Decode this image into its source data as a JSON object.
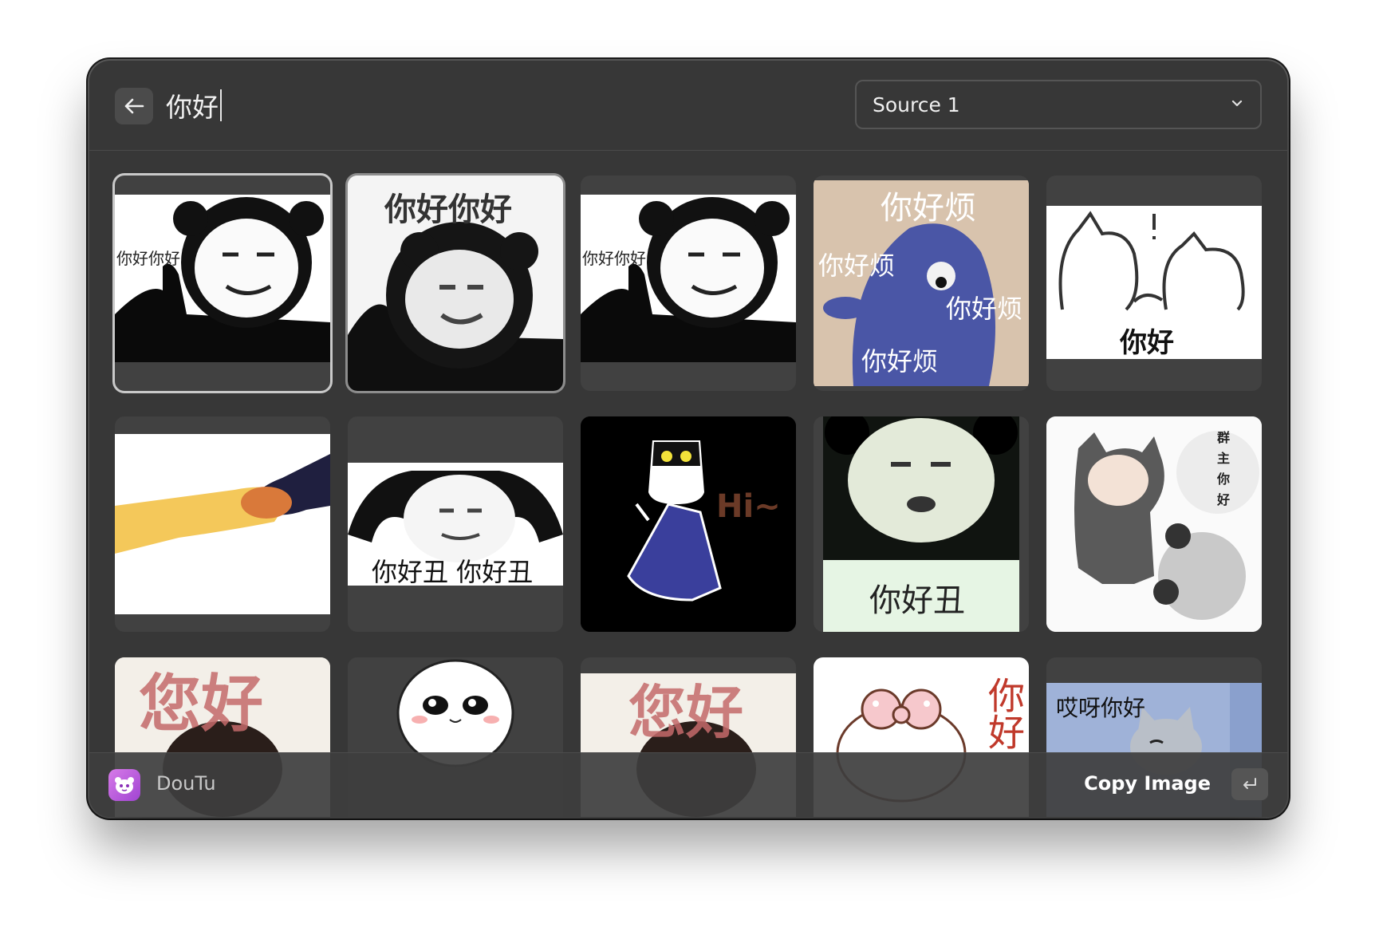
{
  "header": {
    "query": "你好",
    "source_selected": "Source 1"
  },
  "results": [
    {
      "caption": "你好你好"
    },
    {
      "caption": "你好你好"
    },
    {
      "caption": "你好你好"
    },
    {
      "caption_top": "你好烦",
      "caption_left": "你好烦",
      "caption_right": "你好烦",
      "caption_bottom": "你好烦"
    },
    {
      "caption": "你好"
    },
    {
      "caption": ""
    },
    {
      "caption": "你好丑 你好丑"
    },
    {
      "caption": "Hi~"
    },
    {
      "caption": "你好丑"
    },
    {
      "caption": "群主你好"
    },
    {
      "caption": "您好"
    },
    {
      "caption": ""
    },
    {
      "caption": "您好"
    },
    {
      "caption": "你好"
    },
    {
      "caption": "哎呀你好"
    }
  ],
  "footer": {
    "app_name": "DouTu",
    "action_label": "Copy Image"
  }
}
